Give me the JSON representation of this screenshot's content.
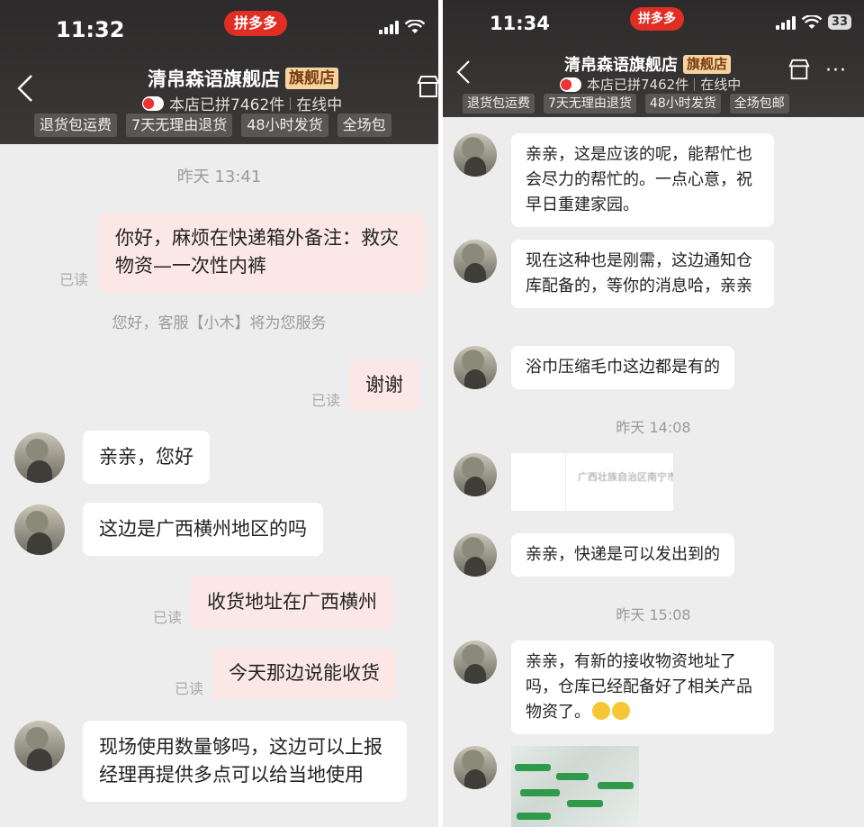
{
  "left_phone": {
    "status_bar": {
      "time": "11:32"
    },
    "pdd_logo": "拼多多",
    "header": {
      "shop_name": "清帛森语旗舰店",
      "flagship_badge": "旗舰店",
      "sales": "本店已拼7462件",
      "online": "在线中",
      "tags": [
        "退货包运费",
        "7天无理由退货",
        "48小时发货",
        "全场包"
      ]
    },
    "messages": [
      {
        "type": "time",
        "text": "昨天 13:41"
      },
      {
        "type": "out",
        "text": "你好，麻烦在快递箱外备注：救灾物资—一次性内裤",
        "read": "已读"
      },
      {
        "type": "system",
        "text": "您好，客服【小木】将为您服务"
      },
      {
        "type": "out",
        "text": "谢谢",
        "read": "已读"
      },
      {
        "type": "in",
        "text": "亲亲，您好"
      },
      {
        "type": "in",
        "text": "这边是广西横州地区的吗"
      },
      {
        "type": "out",
        "text": "收货地址在广西横州",
        "read": "已读"
      },
      {
        "type": "out",
        "text": "今天那边说能收货",
        "read": "已读"
      },
      {
        "type": "in",
        "text": "现场使用数量够吗，这边可以上报经理再提供多点可以给当地使用"
      }
    ]
  },
  "right_phone": {
    "status_bar": {
      "time": "11:34",
      "battery": "33"
    },
    "pdd_logo": "拼多多",
    "header": {
      "shop_name": "清帛森语旗舰店",
      "flagship_badge": "旗舰店",
      "sales": "本店已拼7462件",
      "online": "在线中",
      "more": "···",
      "tags": [
        "退货包运费",
        "7天无理由退货",
        "48小时发货",
        "全场包邮"
      ]
    },
    "messages": [
      {
        "type": "in",
        "text": "亲亲，这是应该的呢，能帮忙也会尽力的帮忙的。一点心意，祝早日重建家园。"
      },
      {
        "type": "in",
        "text": "现在这种也是刚需，这边通知仓库配备的，等你的消息哈，亲亲"
      },
      {
        "type": "in",
        "text": "浴巾压缩毛巾这边都是有的"
      },
      {
        "type": "time",
        "text": "昨天 14:08"
      },
      {
        "type": "image",
        "text": "广西壮族自治区南宁市"
      },
      {
        "type": "in",
        "text": "亲亲，快递是可以发出到的"
      },
      {
        "type": "time",
        "text": "昨天 15:08"
      },
      {
        "type": "in",
        "text": "亲亲，有新的接收物资地址了吗，仓库已经配备好了相关产品物资了。",
        "emoji": "smile-emoji"
      },
      {
        "type": "image",
        "text": ""
      }
    ]
  },
  "colors": {
    "header_bg": "#3b3837",
    "badge": "#f7d3a0",
    "out_bubble": "#fbe8e6",
    "pdd_red": "#e02e24"
  }
}
